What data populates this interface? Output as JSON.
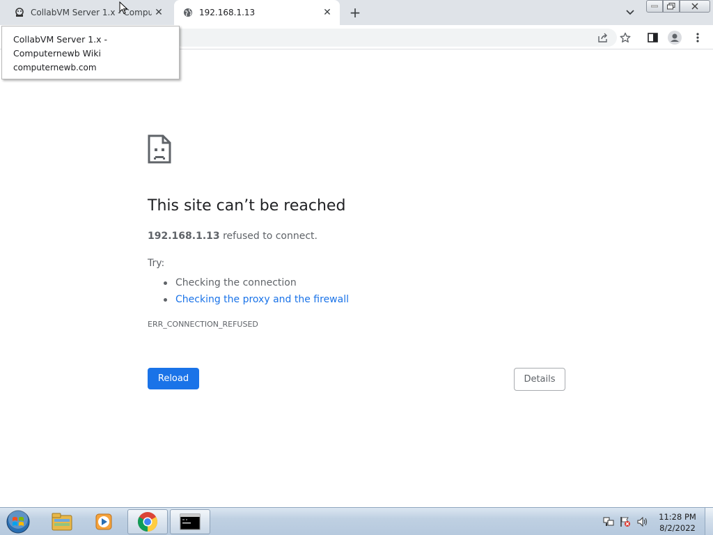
{
  "browser": {
    "tabs": [
      {
        "title": "CollabVM Server 1.x - Computernewb Wiki",
        "icon": "collabvm-favicon-icon",
        "close": "✕"
      },
      {
        "title": "192.168.1.13",
        "icon": "globe-icon",
        "close": "✕"
      }
    ],
    "new_tab": "+",
    "tooltip": {
      "title": "CollabVM Server 1.x - Computernewb Wiki",
      "url": "computernewb.com"
    },
    "toolbar_icons": [
      "share-icon",
      "bookmark-star-icon",
      "side-panel-icon",
      "profile-icon",
      "menu-icon"
    ]
  },
  "error_page": {
    "title": "This site can’t be reached",
    "host": "192.168.1.13",
    "summary_suffix": " refused to connect.",
    "try_label": "Try:",
    "suggestions": [
      {
        "text": "Checking the connection",
        "link": false
      },
      {
        "text": "Checking the proxy and the firewall",
        "link": true
      }
    ],
    "error_code": "ERR_CONNECTION_REFUSED",
    "reload_label": "Reload",
    "details_label": "Details"
  },
  "taskbar": {
    "pinned": [
      "explorer-icon",
      "media-player-icon",
      "chrome-icon",
      "cmd-icon"
    ],
    "clock_time": "11:28 PM",
    "clock_date": "8/2/2022"
  },
  "colors": {
    "accent": "#1a73e8",
    "text_secondary": "#5f6368"
  }
}
